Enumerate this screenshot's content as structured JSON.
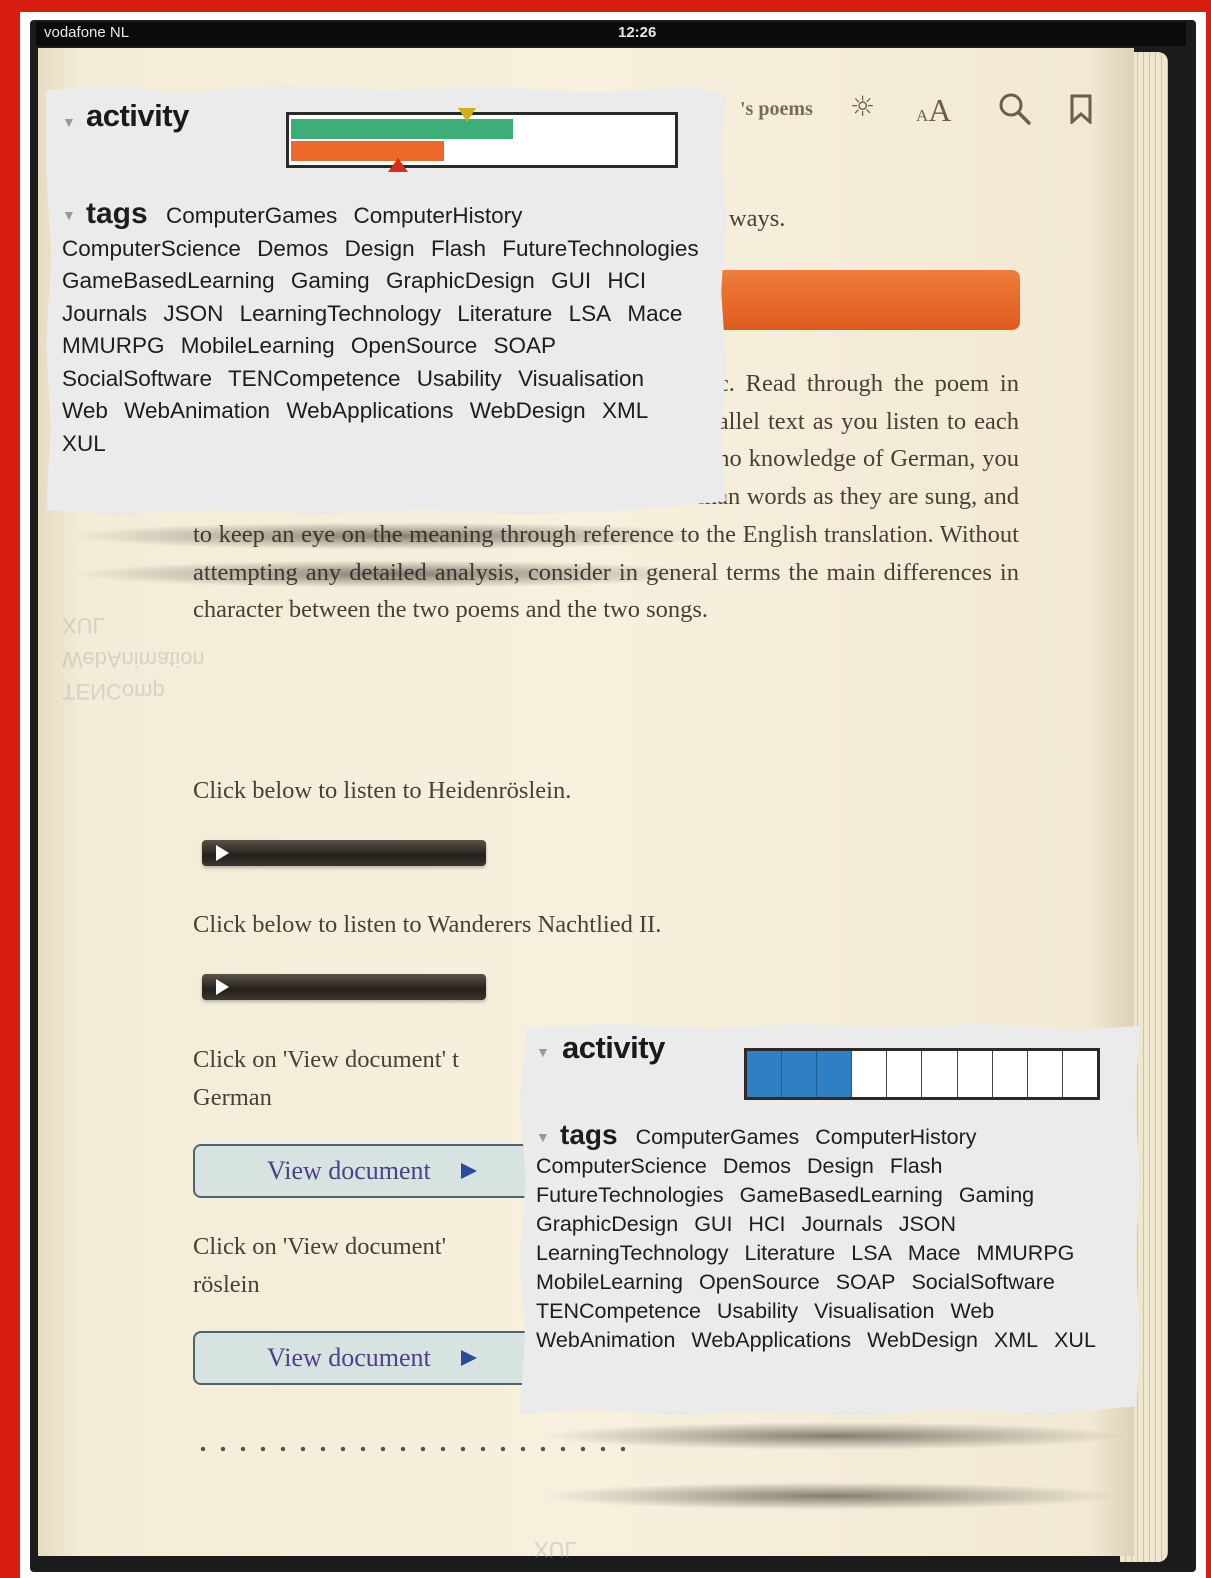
{
  "status_bar": {
    "carrier": "vodafone NL",
    "time": "12:26"
  },
  "book": {
    "title_fragment": "'s poems",
    "line_fragment": "t ways.",
    "paragraph": "Now listen to the two songs and look at the music. Read through the poem in English and German, following the words in the parallel text as you listen to each song. You should find that, even if you have little or no knowledge of German, you will, with a little practice, be able to follow the German words as they are sung, and to keep an eye on the meaning through reference to the English translation. Without attempting any detailed analysis, consider in general terms the main differences in character between the two poems and the two songs.",
    "listen_1": "Click below to listen to Heidenröslein.",
    "listen_2": "Click below to listen to Wanderers Nachtlied II.",
    "view_doc_1_text": "Click on 'View document' t",
    "view_doc_1_text_2": "German",
    "view_doc_2_text": "Click on 'View document'",
    "view_doc_2_text_2": "röslein",
    "view_button_label": "View document"
  },
  "widget_top": {
    "activity_label": "activity",
    "tags_label": "tags",
    "activity_green_fraction": 0.58,
    "activity_orange_fraction": 0.4,
    "marker_top_fraction": 0.46,
    "marker_bottom_fraction": 0.28
  },
  "widget_bottom": {
    "activity_label": "activity",
    "tags_label": "tags",
    "segments_total": 10,
    "segments_filled": 3
  },
  "tags": [
    "ComputerGames",
    "ComputerHistory",
    "ComputerScience",
    "Demos",
    "Design",
    "Flash",
    "FutureTechnologies",
    "GameBasedLearning",
    "Gaming",
    "GraphicDesign",
    "GUI",
    "HCI",
    "Journals",
    "JSON",
    "LearningTechnology",
    "Literature",
    "LSA",
    "Mace",
    "MMURPG",
    "MobileLearning",
    "OpenSource",
    "SOAP",
    "SocialSoftware",
    "TENCompetence",
    "Usability",
    "Visualisation",
    "Web",
    "WebAnimation",
    "WebApplications",
    "WebDesign",
    "XML",
    "XUL"
  ],
  "ghost": {
    "xul": "XUL",
    "webanim": "WebAnimation",
    "tencomp": "TENComp"
  },
  "icons": [
    "brightness-icon",
    "font-size-icon",
    "search-icon",
    "bookmark-icon",
    "play-icon",
    "arrow-right-icon",
    "caret-down-icon"
  ],
  "colors": {
    "frame": "#d81c12",
    "green": "#3eae78",
    "orange": "#ee6a2a",
    "blue": "#2f7fc4"
  }
}
